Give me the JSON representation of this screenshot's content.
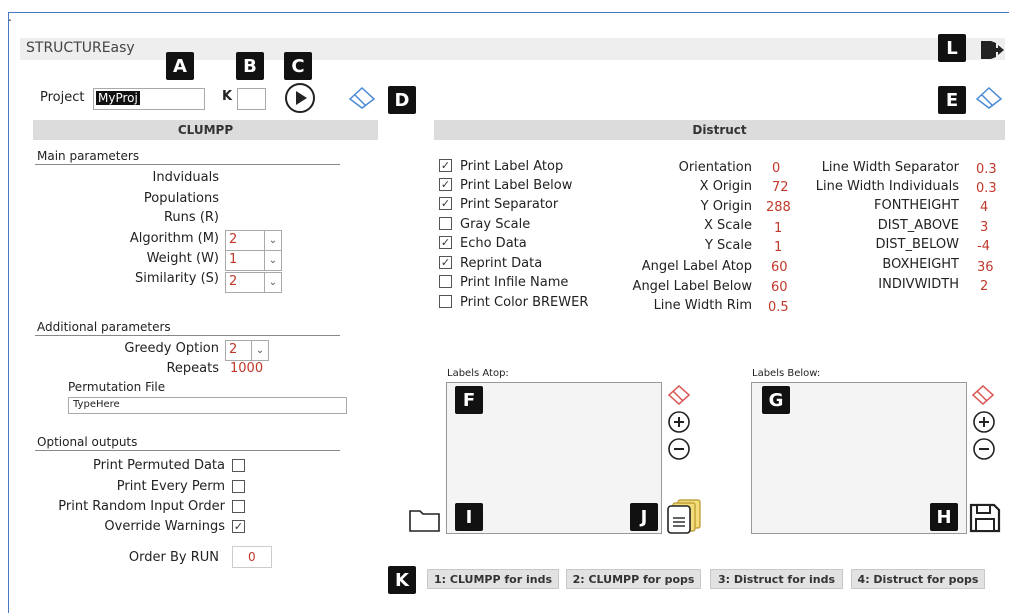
{
  "app": {
    "title": "STRUCTUREasy",
    "dot": "."
  },
  "markers": {
    "A": "A",
    "B": "B",
    "C": "C",
    "D": "D",
    "E": "E",
    "F": "F",
    "G": "G",
    "H": "H",
    "I": "I",
    "J": "J",
    "K": "K",
    "L": "L"
  },
  "project": {
    "label": "Project",
    "value": "MyProj",
    "k_label": "K",
    "k_value": ""
  },
  "clumpp": {
    "header": "CLUMPP",
    "main": {
      "title": "Main parameters",
      "individuals": "Indviduals",
      "populations": "Populations",
      "runs": "Runs (R)",
      "algorithm_label": "Algorithm (M)",
      "algorithm_value": "2",
      "weight_label": "Weight (W)",
      "weight_value": "1",
      "similarity_label": "Similarity (S)",
      "similarity_value": "2"
    },
    "additional": {
      "title": "Additional parameters",
      "greedy_label": "Greedy Option",
      "greedy_value": "2",
      "repeats_label": "Repeats",
      "repeats_value": "1000",
      "perm_label": "Permutation File",
      "perm_value": "TypeHere"
    },
    "optional": {
      "title": "Optional outputs",
      "items": [
        {
          "label": "Print Permuted Data",
          "checked": false
        },
        {
          "label": "Print Every Perm",
          "checked": false
        },
        {
          "label": "Print Random Input Order",
          "checked": false
        },
        {
          "label": "Override Warnings",
          "checked": true
        }
      ],
      "order_label": "Order By RUN",
      "order_value": "0"
    }
  },
  "distruct": {
    "header": "Distruct",
    "checks": [
      {
        "label": "Print Label Atop",
        "checked": true
      },
      {
        "label": "Print Label Below",
        "checked": true
      },
      {
        "label": "Print Separator",
        "checked": true
      },
      {
        "label": "Gray Scale",
        "checked": false
      },
      {
        "label": "Echo Data",
        "checked": true
      },
      {
        "label": "Reprint Data",
        "checked": true
      },
      {
        "label": "Print Infile Name",
        "checked": false
      },
      {
        "label": "Print Color BREWER",
        "checked": false
      }
    ],
    "mid_params": [
      {
        "label": "Orientation",
        "value": "0"
      },
      {
        "label": "X Origin",
        "value": "72"
      },
      {
        "label": "Y Origin",
        "value": "288"
      },
      {
        "label": "X Scale",
        "value": "1"
      },
      {
        "label": "Y Scale",
        "value": "1"
      },
      {
        "label": "Angel Label Atop",
        "value": "60"
      },
      {
        "label": "Angel Label Below",
        "value": "60"
      },
      {
        "label": "Line Width Rim",
        "value": "0.5"
      }
    ],
    "right_params": [
      {
        "label": "Line Width Separator",
        "value": "0.3"
      },
      {
        "label": "Line Width Individuals",
        "value": "0.3"
      },
      {
        "label": "FONTHEIGHT",
        "value": "4"
      },
      {
        "label": "DIST_ABOVE",
        "value": "3"
      },
      {
        "label": "DIST_BELOW",
        "value": "-4"
      },
      {
        "label": "BOXHEIGHT",
        "value": "36"
      },
      {
        "label": "INDIVWIDTH",
        "value": "2"
      }
    ],
    "labels_atop": "Labels Atop:",
    "labels_below": "Labels Below:"
  },
  "buttons": {
    "b1": "1: CLUMPP for inds",
    "b2": "2: CLUMPP for pops",
    "b3": "3: Distruct for inds",
    "b4": "4: Distruct for pops"
  },
  "icons": [
    "exit-icon",
    "play-icon",
    "eraser-icon",
    "plus-icon",
    "minus-icon",
    "folder-icon",
    "documents-icon",
    "save-icon"
  ]
}
